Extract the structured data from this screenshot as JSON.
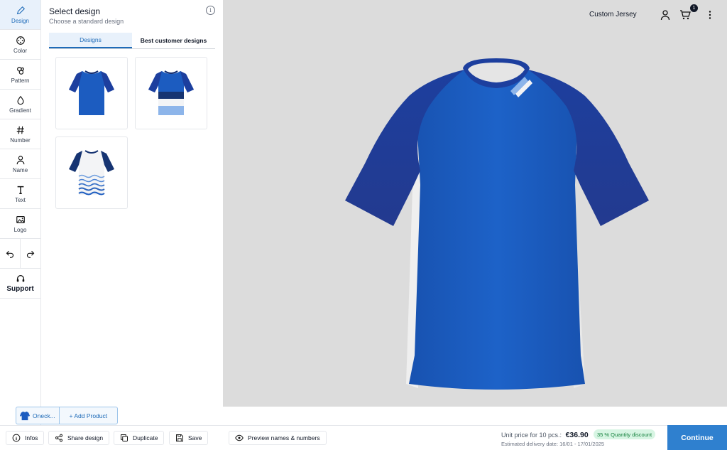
{
  "rail": {
    "items": [
      {
        "label": "Design",
        "icon": "pencil-icon"
      },
      {
        "label": "Color",
        "icon": "palette-icon"
      },
      {
        "label": "Pattern",
        "icon": "pattern-icon"
      },
      {
        "label": "Gradient",
        "icon": "drop-icon"
      },
      {
        "label": "Number",
        "icon": "hash-icon"
      },
      {
        "label": "Name",
        "icon": "person-icon"
      },
      {
        "label": "Text",
        "icon": "text-icon"
      },
      {
        "label": "Logo",
        "icon": "image-icon"
      }
    ],
    "support_label": "Support"
  },
  "panel": {
    "title": "Select design",
    "subtitle": "Choose a standard design",
    "tabs": [
      "Designs",
      "Best customer designs"
    ],
    "active_tab": "Designs"
  },
  "header": {
    "title": "Custom Jersey",
    "cart_count": "1"
  },
  "product_chip": {
    "product_label": "Oneck...",
    "add_label": "+ Add Product"
  },
  "bottombar": {
    "infos": "Infos",
    "share": "Share design",
    "duplicate": "Duplicate",
    "save": "Save",
    "preview": "Preview names & numbers",
    "price_label": "Unit price for 10 pcs.:",
    "price_value": "€36.90",
    "discount": "35 % Quantity discount",
    "delivery": "Estimated delivery date: 16/01 - 17/01/2025",
    "continue": "Continue"
  },
  "colors": {
    "accent": "#2f80cf",
    "jersey_body": "#1c5cc0",
    "jersey_sleeve": "#1d3f9e",
    "viewport_bg": "#dcdcdc"
  }
}
